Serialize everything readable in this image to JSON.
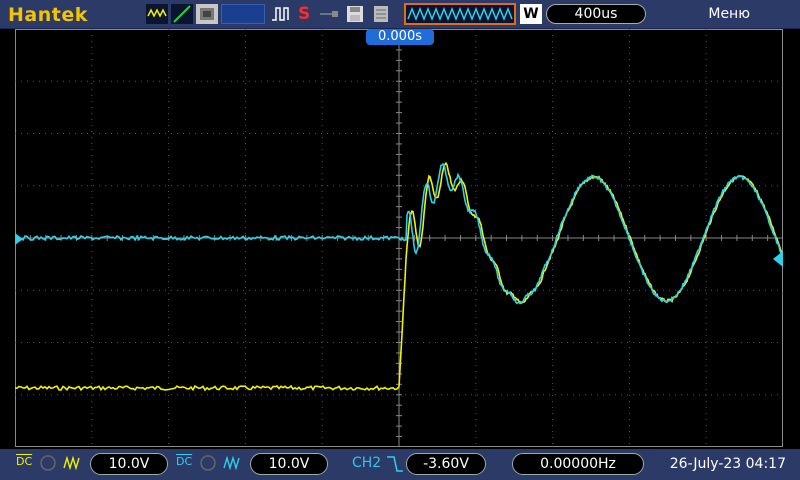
{
  "header": {
    "brand": "Hantek",
    "menu_label": "Меню",
    "timebase": "400us",
    "acq_mode": "W",
    "run_state": "S",
    "icons": [
      "ch-waveform-icon",
      "math-line-icon",
      "persistence-icon",
      "cursor-icon",
      "trigger-pulse-icon",
      "save-icon",
      "print-icon"
    ]
  },
  "display": {
    "trigger_time": "0.000s"
  },
  "footer": {
    "ch1_coupling": "DC",
    "ch1_scale": "10.0V",
    "ch2_coupling": "DC",
    "ch2_scale": "10.0V",
    "trigger_source": "CH2",
    "trigger_level": "-3.60V",
    "frequency": "0.00000Hz",
    "datetime": "26-July-23 04:17"
  },
  "colors": {
    "ch1": "#f2f200",
    "ch2": "#30d0e8",
    "bar": "#2b3a67",
    "accent": "#e06d1c"
  }
}
